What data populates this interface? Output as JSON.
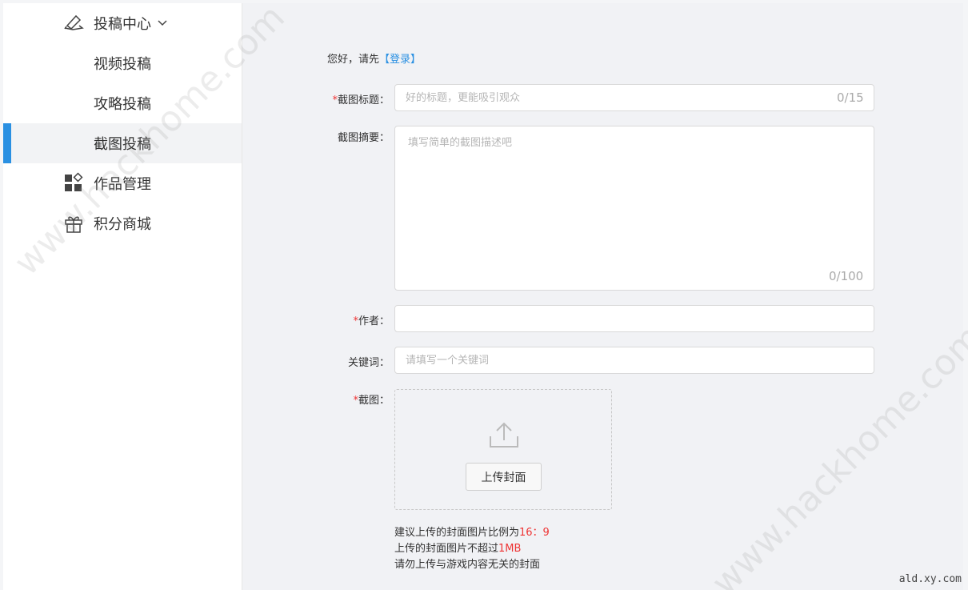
{
  "sidebar": {
    "submit_center": {
      "label": "投稿中心",
      "icon": "pen-paper-icon",
      "chevron": "chevron-down-icon"
    },
    "sub_items": [
      {
        "label": "视频投稿",
        "active": false
      },
      {
        "label": "攻略投稿",
        "active": false
      },
      {
        "label": "截图投稿",
        "active": true
      }
    ],
    "works_manage": {
      "label": "作品管理",
      "icon": "grid-apps-icon"
    },
    "points_mall": {
      "label": "积分商城",
      "icon": "gift-icon"
    },
    "active_color": "#2a90e2"
  },
  "main": {
    "greeting": {
      "text": "您好，请先",
      "login": "【登录】"
    },
    "title_field": {
      "required": "*",
      "label": "截图标题：",
      "placeholder": "好的标题，更能吸引观众",
      "value": "",
      "counter": "0/15"
    },
    "summary_field": {
      "label": "截图摘要：",
      "placeholder": "填写简单的截图描述吧",
      "value": "",
      "counter": "0/100"
    },
    "author_field": {
      "required": "*",
      "label": "作者：",
      "placeholder": "",
      "value": ""
    },
    "keyword_field": {
      "label": "关键词：",
      "placeholder": "请填写一个关键词",
      "value": ""
    },
    "screenshot_field": {
      "required": "*",
      "label": "截图：",
      "upload_icon": "upload-icon",
      "upload_button": "上传封面"
    },
    "hints": {
      "line1_prefix": "建议上传的封面图片比例为",
      "line1_value": "16：9",
      "line2_prefix": "上传的封面图片不超过",
      "line2_value": "1MB",
      "line3": "请勿上传与游戏内容无关的封面"
    }
  },
  "watermarks": {
    "left": "www.hackhome.com",
    "right": "www.hackhome.com",
    "corner": "ald.xy.com"
  },
  "colors": {
    "required": "#e33333",
    "link": "#2a90e2"
  }
}
